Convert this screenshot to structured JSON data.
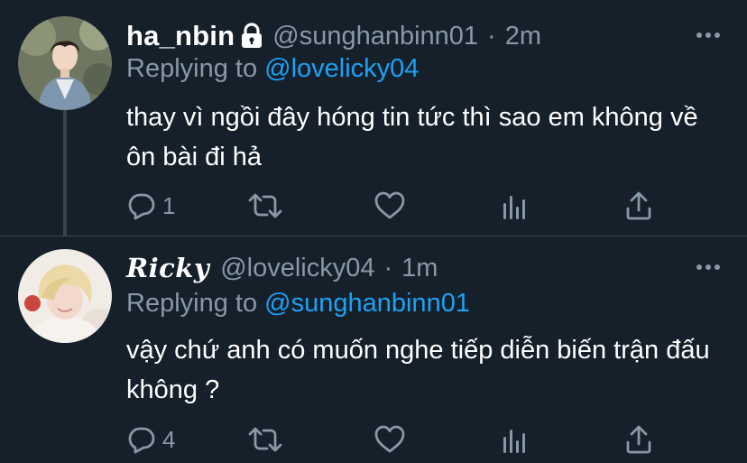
{
  "tweets": [
    {
      "display_name": "ha_nbin",
      "handle": "@sunghanbinn01",
      "separator": "·",
      "time": "2m",
      "replying_prefix": "Replying to",
      "replying_to": "@lovelicky04",
      "body": "thay vì ngồi đây hóng tin tức thì sao em không về ôn bài đi hả",
      "reply_count": "1",
      "protected": true
    },
    {
      "display_name": "𝑹𝒊𝒄𝒌𝒚",
      "handle": "@lovelicky04",
      "separator": "·",
      "time": "1m",
      "replying_prefix": "Replying to",
      "replying_to": "@sunghanbinn01",
      "body": "vậy chứ anh có muốn nghe tiếp diễn biến trận đấu không ?",
      "reply_count": "4",
      "protected": false
    }
  ],
  "icons": {
    "reply": "reply-icon",
    "retweet": "retweet-icon",
    "like": "heart-icon",
    "stats": "analytics-icon",
    "share": "share-icon",
    "more": "more-icon",
    "lock": "lock-icon"
  },
  "colors": {
    "background": "#15202b",
    "text": "#ffffff",
    "secondary": "#8899a6",
    "link": "#1da1f2",
    "divider": "#38444d"
  }
}
